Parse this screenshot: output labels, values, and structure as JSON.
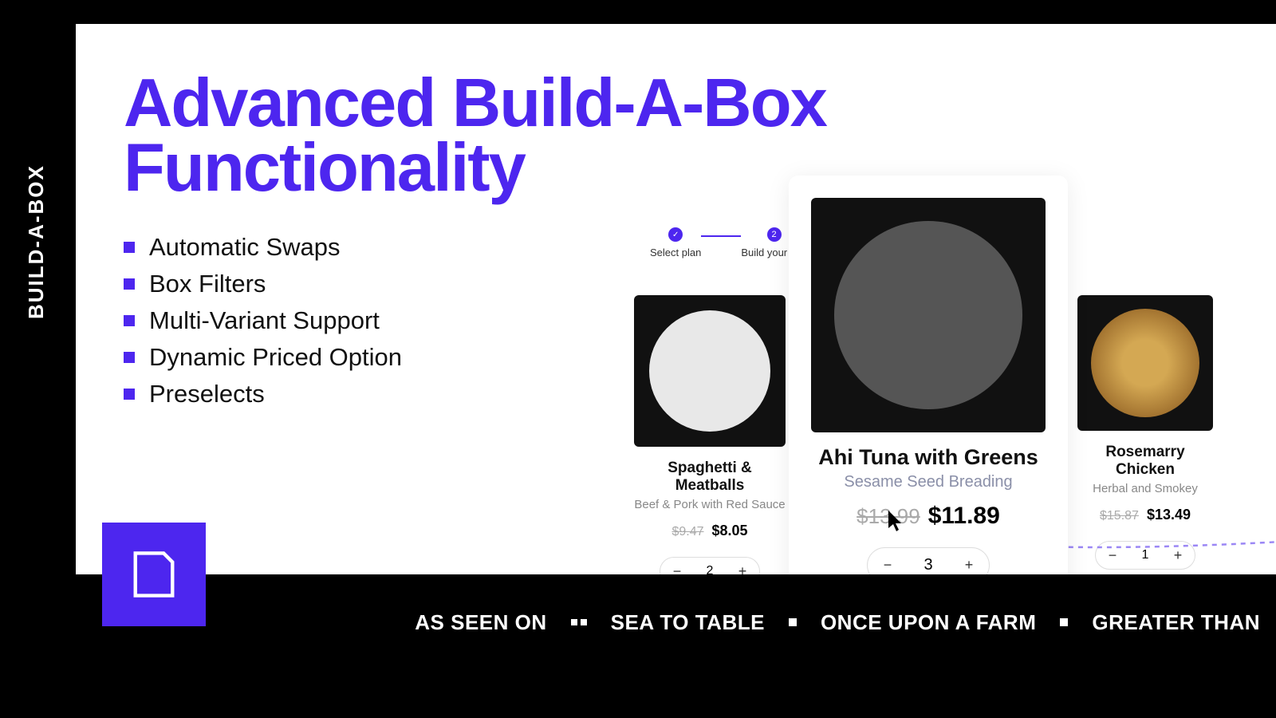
{
  "sidebar_label": "BUILD-A-BOX",
  "title_line1": "Advanced Build-A-Box",
  "title_line2": "Functionality",
  "bullets": [
    "Automatic Swaps",
    "Box Filters",
    "Multi-Variant Support",
    "Dynamic Priced Option",
    "Preselects"
  ],
  "stepper": {
    "step1": "Select plan",
    "step2_num": "2",
    "step2": "Build your box"
  },
  "products": [
    {
      "name": "Spaghetti & Meatballs",
      "sub": "Beef & Pork with Red Sauce",
      "old": "$9.47",
      "new": "$8.05",
      "qty": "2"
    },
    {
      "name": "Ahi Tuna with Greens",
      "sub": "Sesame Seed Breading",
      "old": "$13.99",
      "new": "$11.89",
      "qty": "3"
    },
    {
      "name": "Rosemarry Chicken",
      "sub": "Herbal and Smokey",
      "old": "$15.87",
      "new": "$13.49",
      "qty": "1"
    }
  ],
  "colors": {
    "accent": "#4d26ef"
  },
  "footer": {
    "label": "AS SEEN ON",
    "items": [
      "SEA TO TABLE",
      "ONCE UPON A FARM",
      "GREATER THAN"
    ]
  }
}
